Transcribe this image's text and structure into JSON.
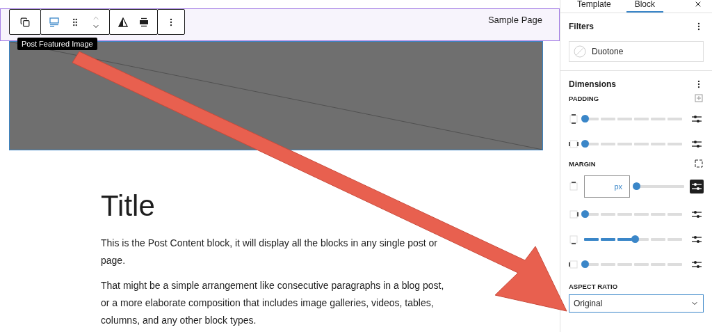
{
  "header": {
    "site_link": "Sample Page"
  },
  "block_toolbar": {
    "tooltip": "Post Featured Image"
  },
  "content": {
    "title": "Title",
    "paragraphs": [
      "This is the Post Content block, it will display all the blocks in any single post or page.",
      "That might be a simple arrangement like consecutive paragraphs in a blog post, or a more elaborate composition that includes image galleries, videos, tables, columns, and any other block types."
    ]
  },
  "sidebar": {
    "tabs": [
      {
        "label": "Template",
        "selected": false
      },
      {
        "label": "Block",
        "selected": true
      }
    ],
    "filters": {
      "title": "Filters",
      "duotone": "Duotone"
    },
    "dimensions": {
      "title": "Dimensions",
      "padding": {
        "label": "PADDING",
        "rows": [
          {
            "kind": "preset",
            "level": 0
          },
          {
            "kind": "preset",
            "level": 0
          }
        ]
      },
      "margin": {
        "label": "MARGIN",
        "rows": [
          {
            "kind": "custom",
            "unit": "px",
            "level": 0
          },
          {
            "kind": "preset",
            "level": 0
          },
          {
            "kind": "preset",
            "level": 0.5
          },
          {
            "kind": "preset",
            "level": 0
          }
        ]
      }
    },
    "aspect_ratio": {
      "label": "ASPECT RATIO",
      "value": "Original"
    }
  }
}
